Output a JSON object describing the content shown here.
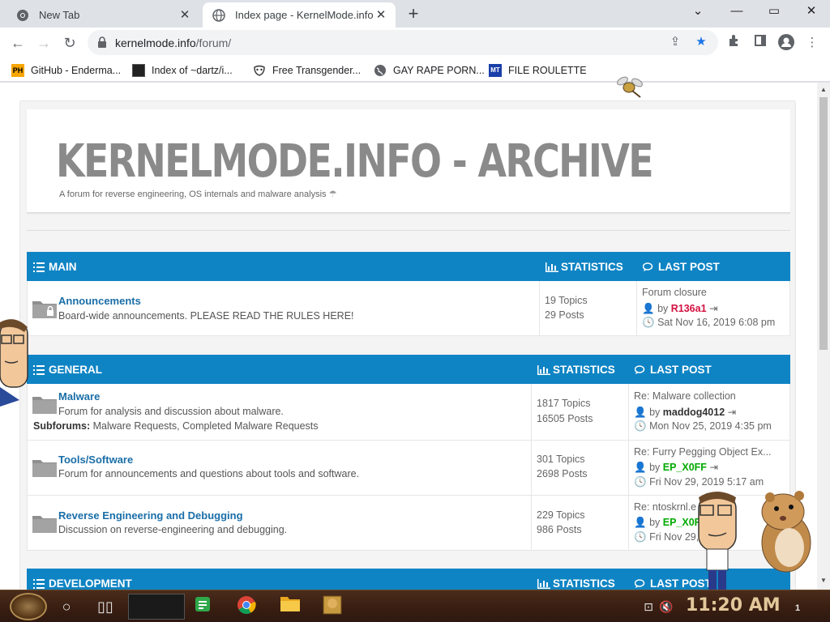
{
  "browser": {
    "tabs": [
      {
        "title": "New Tab",
        "active": false
      },
      {
        "title": "Index page - KernelMode.info",
        "active": true
      }
    ],
    "new_tab": "+",
    "window_controls": [
      "—",
      "▭",
      "✕"
    ],
    "url_host": "kernelmode.info",
    "url_path": "/forum/",
    "bookmarks": [
      {
        "label": "GitHub - Enderma...",
        "icon": "PH"
      },
      {
        "label": "Index of ~dartz/i...",
        "icon": "app-icon"
      },
      {
        "label": "Free Transgender...",
        "icon": "mask-icon"
      },
      {
        "label": "GAY RAPE PORN...",
        "icon": "globe-icon"
      },
      {
        "label": "FILE ROULETTE",
        "icon": "MT"
      }
    ]
  },
  "site": {
    "title": "KERNELMODE.INFO - ARCHIVE",
    "description": "A forum for reverse engineering, OS internals and malware analysis",
    "accent": "#0f84c4"
  },
  "categories": [
    {
      "name": "MAIN",
      "stats_label": "STATISTICS",
      "lastpost_label": "LAST POST",
      "forums": [
        {
          "title": "Announcements",
          "desc": "Board-wide announcements. PLEASE READ THE RULES HERE!",
          "subforums_label": "",
          "subforums": "",
          "topics": "19 Topics",
          "posts": "29 Posts",
          "lp_title": "Forum closure",
          "lp_by": "by",
          "lp_user": "R136a1",
          "lp_date": "Sat Nov 16, 2019 6:08 pm"
        }
      ]
    },
    {
      "name": "GENERAL",
      "stats_label": "STATISTICS",
      "lastpost_label": "LAST POST",
      "forums": [
        {
          "title": "Malware",
          "desc": "Forum for analysis and discussion about malware.",
          "subforums_label": "Subforums:",
          "subforums": "Malware Requests, Completed Malware Requests",
          "topics": "1817 Topics",
          "posts": "16505 Posts",
          "lp_title": "Re: Malware collection",
          "lp_by": "by",
          "lp_user": "maddog4012",
          "lp_date": "Mon Nov 25, 2019 4:35 pm"
        },
        {
          "title": "Tools/Software",
          "desc": "Forum for announcements and questions about tools and software.",
          "subforums_label": "",
          "subforums": "",
          "topics": "301 Topics",
          "posts": "2698 Posts",
          "lp_title": "Re: Furry Pegging Object Ex...",
          "lp_by": "by",
          "lp_user": "EP_X0FF",
          "lp_date": "Fri Nov 29, 2019 5:17 am"
        },
        {
          "title": "Reverse Engineering and Debugging",
          "desc": "Discussion on reverse-engineering and debugging.",
          "subforums_label": "",
          "subforums": "",
          "topics": "229 Topics",
          "posts": "986 Posts",
          "lp_title": "Re: ntoskrnl.e",
          "lp_by": "by",
          "lp_user": "EP_X0F",
          "lp_date": "Fri Nov 29,   :19 am"
        }
      ]
    },
    {
      "name": "DEVELOPMENT",
      "stats_label": "STATISTICS",
      "lastpost_label": "LAST POST",
      "forums": []
    }
  ],
  "taskbar": {
    "clock": "11:20 AM",
    "notification_count": "1"
  }
}
